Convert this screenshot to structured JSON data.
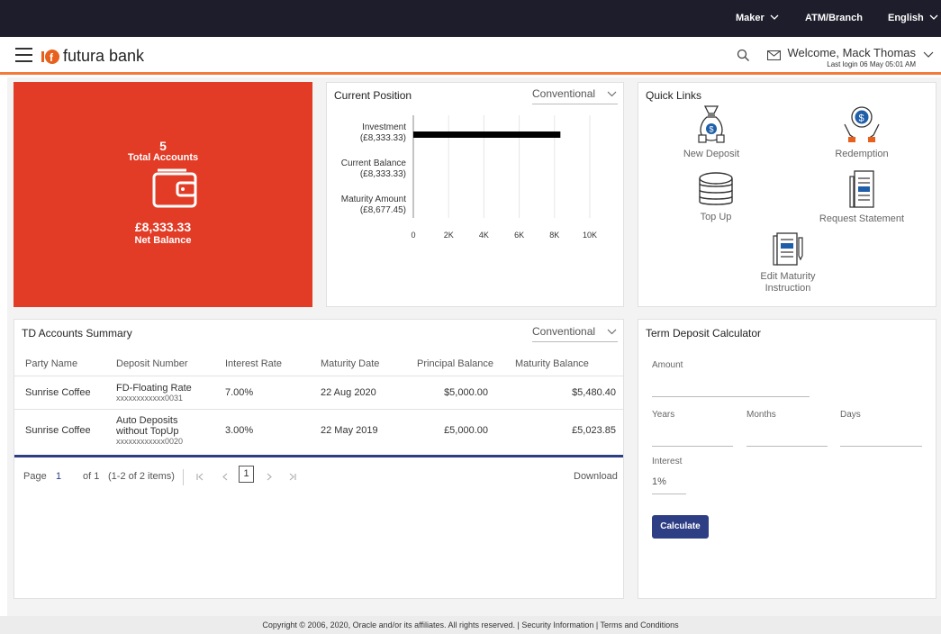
{
  "topbar": {
    "role": "Maker",
    "location": "ATM/Branch",
    "language": "English"
  },
  "header": {
    "brand": "futura bank",
    "welcome": "Welcome, Mack Thomas",
    "last_login": "Last login 06 May 05:01 AM"
  },
  "summary": {
    "count": "5",
    "count_label": "Total Accounts",
    "amount": "£8,333.33",
    "amount_label": "Net Balance"
  },
  "current_position": {
    "title": "Current Position",
    "dropdown": "Conventional",
    "chart_data": {
      "type": "bar",
      "orientation": "horizontal",
      "categories": [
        "Investment",
        "Current Balance",
        "Maturity Amount"
      ],
      "category_sublabels": [
        "(£8,333.33)",
        "(£8,333.33)",
        "(£8,677.45)"
      ],
      "values": [
        8333.33,
        0,
        0
      ],
      "xticks": [
        "0",
        "2K",
        "4K",
        "6K",
        "8K",
        "10K"
      ],
      "xlim": [
        0,
        10000
      ],
      "grid": true,
      "bar_color": "#000000"
    }
  },
  "quick_links": {
    "title": "Quick Links",
    "items": [
      {
        "label": "New Deposit",
        "icon": "money-bag-icon"
      },
      {
        "label": "Redemption",
        "icon": "redemption-icon"
      },
      {
        "label": "Top Up",
        "icon": "coin-stack-icon"
      },
      {
        "label": "Request Statement",
        "icon": "statement-icon"
      },
      {
        "label": "Edit Maturity Instruction",
        "icon": "edit-document-icon"
      }
    ]
  },
  "td_summary": {
    "title": "TD Accounts Summary",
    "dropdown": "Conventional",
    "columns": [
      "Party Name",
      "Deposit Number",
      "Interest Rate",
      "Maturity Date",
      "Principal Balance",
      "Maturity Balance"
    ],
    "rows": [
      {
        "party": "Sunrise Coffee",
        "deposit_name": "FD-Floating Rate",
        "deposit_name_2": "",
        "deposit_number": "xxxxxxxxxxxx0031",
        "rate": "7.00%",
        "maturity_date": "22 Aug 2020",
        "principal": "$5,000.00",
        "maturity_balance": "$5,480.40"
      },
      {
        "party": "Sunrise Coffee",
        "deposit_name": "Auto Deposits",
        "deposit_name_2": "without TopUp",
        "deposit_number": "xxxxxxxxxxxx0020",
        "rate": "3.00%",
        "maturity_date": "22 May 2019",
        "principal": "£5,000.00",
        "maturity_balance": "£5,023.85"
      }
    ],
    "pager": {
      "page_label": "Page",
      "page": "1",
      "of": "of 1",
      "items": "(1-2 of 2 items)",
      "current": "1",
      "download": "Download"
    }
  },
  "calculator": {
    "title": "Term Deposit Calculator",
    "amount_label": "Amount",
    "years_label": "Years",
    "months_label": "Months",
    "days_label": "Days",
    "interest_label": "Interest",
    "interest_value": "1%",
    "button": "Calculate"
  },
  "footer": {
    "text": "Copyright © 2006, 2020, Oracle and/or its affiliates. All rights reserved. | Security Information | Terms and Conditions"
  },
  "colors": {
    "accent_orange": "#f47b3c",
    "summary_red": "#e23b26",
    "primary_blue": "#2e3e84",
    "topbar": "#1d1d2b"
  }
}
